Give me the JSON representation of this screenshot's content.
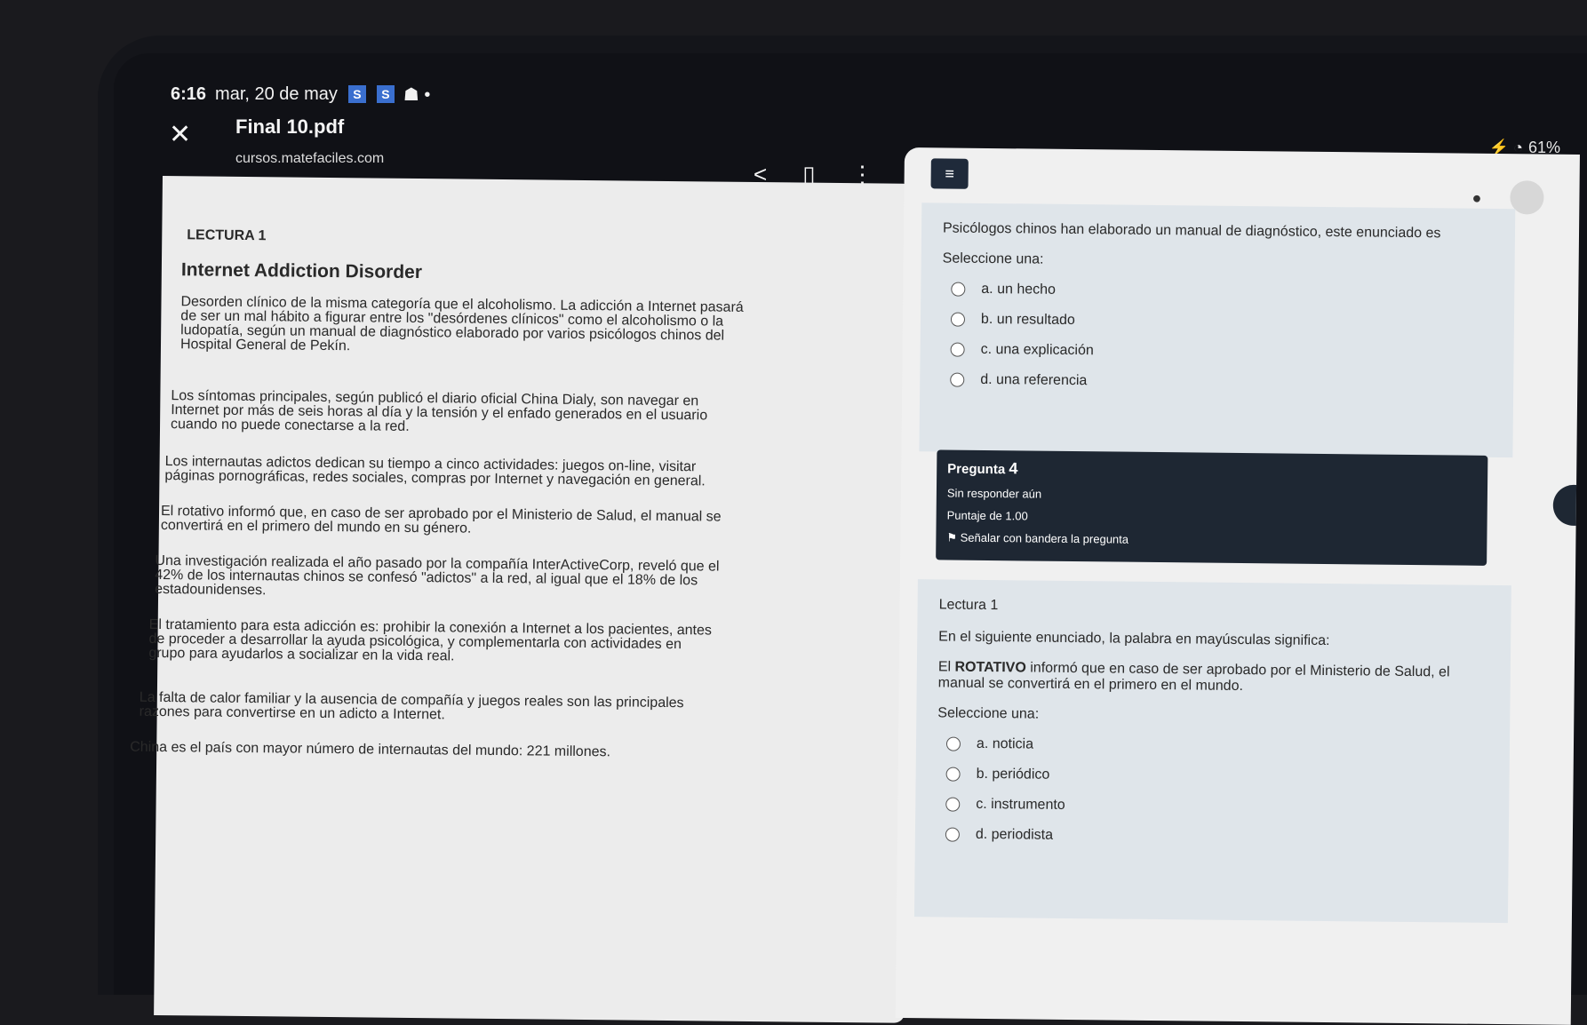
{
  "status": {
    "time": "6:16",
    "date": "mar, 20 de may",
    "badges": [
      "S",
      "S"
    ],
    "battery": "61%"
  },
  "pdf": {
    "title": "Final 10.pdf",
    "url": "cursos.matefaciles.com"
  },
  "document": {
    "lecture": "LECTURA 1",
    "heading": "Internet Addiction Disorder",
    "paragraphs": [
      "Desorden clínico de la misma categoría que el alcoholismo. La adicción a Internet pasará de ser un mal hábito a figurar entre los \"desórdenes clínicos\" como el alcoholismo o la ludopatía, según un manual de diagnóstico elaborado por varios psicólogos chinos del Hospital General de Pekín.",
      "Los síntomas principales, según publicó el diario oficial China Dialy, son navegar en Internet por más de seis horas al día y la tensión y el enfado generados en el usuario cuando no puede conectarse a la red.",
      "Los internautas adictos dedican su tiempo a cinco actividades: juegos on-line, visitar páginas pornográficas, redes sociales, compras por Internet y navegación en general.",
      "El rotativo informó que, en caso de ser aprobado por el Ministerio de Salud, el manual se convertirá en el primero del mundo en su género.",
      "Una investigación realizada el año pasado por la compañía InterActiveCorp, reveló que el 42% de los internautas chinos se confesó \"adictos\" a la red, al igual que el 18% de los estadounidenses.",
      "El tratamiento para esta adicción es: prohibir la conexión a Internet a los pacientes, antes de proceder a desarrollar la ayuda psicológica, y complementarla con actividades en grupo para ayudarlos a socializar en la vida real.",
      "La falta de calor familiar y la ausencia de compañía y juegos reales son las principales razones para convertirse en un adicto a Internet.",
      "China es el país con mayor número de internautas del mundo: 221 millones."
    ]
  },
  "quiz": {
    "menu_icon": "≡",
    "q3": {
      "text": "Psicólogos chinos han elaborado un manual de diagnóstico, este enunciado es",
      "select": "Seleccione una:",
      "options": [
        "a. un hecho",
        "b. un resultado",
        "c. una explicación",
        "d. una referencia"
      ]
    },
    "q4_info": {
      "label": "Pregunta",
      "number": "4",
      "status": "Sin responder aún",
      "score": "Puntaje de 1.00",
      "flag": "Señalar con bandera la pregunta"
    },
    "q4": {
      "reading": "Lectura 1",
      "instruction": "En el siguiente enunciado, la palabra en mayúsculas significa:",
      "statement_prefix": "El ",
      "statement_bold": "ROTATIVO",
      "statement_rest": " informó que en caso de ser aprobado por el Ministerio de Salud, el manual se convertirá en el primero en el mundo.",
      "select": "Seleccione una:",
      "options": [
        "a. noticia",
        "b. periódico",
        "c. instrumento",
        "d. periodista"
      ]
    }
  }
}
